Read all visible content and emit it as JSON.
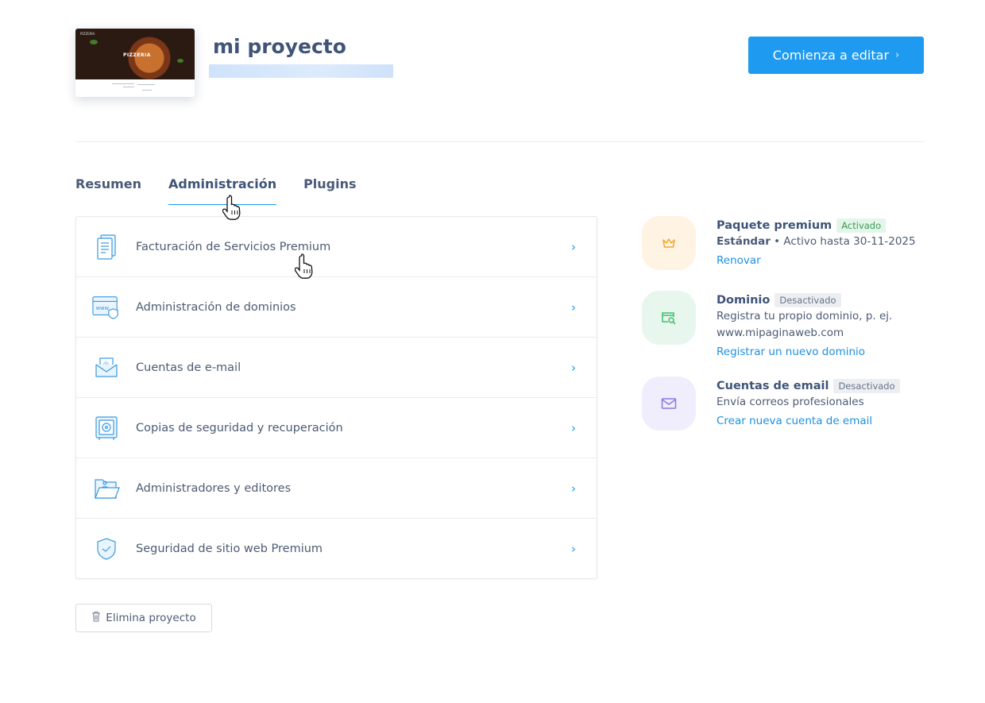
{
  "project": {
    "title": "mi proyecto",
    "thumbnail_brand": "PIZZERIA",
    "thumbnail_logo": "PIZZERIA"
  },
  "header": {
    "edit_button_label": "Comienza a editar",
    "edit_button_icon": "chevron-right-icon"
  },
  "tabs": [
    {
      "label": "Resumen",
      "active": false
    },
    {
      "label": "Administración",
      "active": true
    },
    {
      "label": "Plugins",
      "active": false
    }
  ],
  "menu": {
    "items": [
      {
        "label": "Facturación de Servicios Premium",
        "icon": "invoice-document-icon"
      },
      {
        "label": "Administración de dominios",
        "icon": "domain-browser-icon"
      },
      {
        "label": "Cuentas de e-mail",
        "icon": "email-envelope-icon"
      },
      {
        "label": "Copias de seguridad y recuperación",
        "icon": "safe-backup-icon"
      },
      {
        "label": "Administradores y editores",
        "icon": "users-folder-icon"
      },
      {
        "label": "Seguridad de sitio web Premium",
        "icon": "shield-check-icon"
      }
    ],
    "chevron": "›"
  },
  "features": {
    "premium": {
      "title": "Paquete premium",
      "badge": "Activado",
      "plan": "Estándar",
      "status": " • Activo hasta 30-11-2025",
      "link": "Renovar",
      "icon": "crown-icon",
      "icon_color": "#f2a62a",
      "bg_color": "#fff4e3"
    },
    "domain": {
      "title": "Dominio",
      "badge": "Desactivado",
      "line1": "Registra tu propio dominio, p. ej.",
      "line2": "www.mipaginaweb.com",
      "link": "Registrar un nuevo dominio",
      "icon": "domain-search-icon",
      "icon_color": "#3cbf6a",
      "bg_color": "#e8f7ee"
    },
    "email": {
      "title": "Cuentas de email",
      "badge": "Desactivado",
      "line1": "Envía correos profesionales",
      "link": "Crear nueva cuenta de email",
      "icon": "mail-icon",
      "icon_color": "#8a78e6",
      "bg_color": "#f0eefc"
    }
  },
  "delete_button_label": "Elimina proyecto",
  "colors": {
    "accent": "#1e9af0",
    "text": "#3f5478"
  }
}
